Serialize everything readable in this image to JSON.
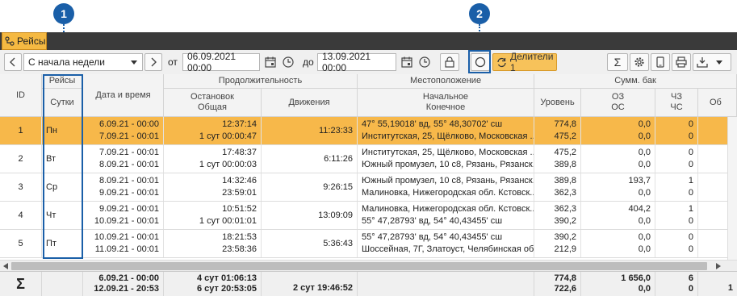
{
  "callouts": [
    "1",
    "2"
  ],
  "tab": {
    "label": "Рейсы"
  },
  "toolbar": {
    "period": "С начала недели",
    "from_label": "от",
    "from_value": "06.09.2021 00:00",
    "to_label": "до",
    "to_value": "13.09.2021 00:00",
    "dividers_label": "Делители 1"
  },
  "headers": {
    "id": "ID",
    "trips": "Рейсы",
    "days": "Сутки",
    "datetime": "Дата и время",
    "duration": "Продолжительность",
    "stops": "Остановок",
    "total": "Общая",
    "moving": "Движения",
    "location": "Местоположение",
    "start": "Начальное",
    "end": "Конечное",
    "tank": "Сумм. бак",
    "level": "Уровень",
    "oz": "ОЗ",
    "os": "ОС",
    "chz": "ЧЗ",
    "chs": "ЧС",
    "ob": "Об"
  },
  "rows": [
    {
      "id": "1",
      "day": "Пн",
      "dt1": "6.09.21 - 00:00",
      "dt2": "7.09.21 - 00:01",
      "stops": "12:37:14",
      "total": "1 сут 00:00:47",
      "moving": "11:23:33",
      "loc1": "47° 55,19018' вд, 55° 48,30702' сш",
      "loc2": "Институтская, 25, Щёлково, Московская ...",
      "lvl1": "774,8",
      "lvl2": "475,2",
      "oz": "0,0",
      "os": "0,0",
      "chz": "0",
      "chs": "0"
    },
    {
      "id": "2",
      "day": "Вт",
      "dt1": "7.09.21 - 00:01",
      "dt2": "8.09.21 - 00:01",
      "stops": "17:48:37",
      "total": "1 сут 00:00:03",
      "moving": "6:11:26",
      "loc1": "Институтская, 25, Щёлково, Московская ...",
      "loc2": "Южный промузел, 10 с8, Рязань, Рязанск...",
      "lvl1": "475,2",
      "lvl2": "389,8",
      "oz": "0,0",
      "os": "0,0",
      "chz": "0",
      "chs": "0"
    },
    {
      "id": "3",
      "day": "Ср",
      "dt1": "8.09.21 - 00:01",
      "dt2": "9.09.21 - 00:01",
      "stops": "14:32:46",
      "total": "23:59:01",
      "moving": "9:26:15",
      "loc1": "Южный промузел, 10 с8, Рязань, Рязанск...",
      "loc2": "Малиновка, Нижегородская обл. Кстовск...",
      "lvl1": "389,8",
      "lvl2": "362,3",
      "oz": "193,7",
      "os": "0,0",
      "chz": "1",
      "chs": "0"
    },
    {
      "id": "4",
      "day": "Чт",
      "dt1": "9.09.21 - 00:01",
      "dt2": "10.09.21 - 00:01",
      "stops": "10:51:52",
      "total": "1 сут 00:01:01",
      "moving": "13:09:09",
      "loc1": "Малиновка, Нижегородская обл. Кстовск...",
      "loc2": "55° 47,28793' вд, 54° 40,43455' сш",
      "lvl1": "362,3",
      "lvl2": "390,2",
      "oz": "404,2",
      "os": "0,0",
      "chz": "1",
      "chs": "0"
    },
    {
      "id": "5",
      "day": "Пт",
      "dt1": "10.09.21 - 00:01",
      "dt2": "11.09.21 - 00:01",
      "stops": "18:21:53",
      "total": "23:58:36",
      "moving": "5:36:43",
      "loc1": "55° 47,28793' вд, 54° 40,43455' сш",
      "loc2": "Шоссейная, 7Г, Златоуст, Челябинская об...",
      "lvl1": "390,2",
      "lvl2": "212,9",
      "oz": "0,0",
      "os": "0,0",
      "chz": "0",
      "chs": "0"
    }
  ],
  "footer": {
    "sigma": "Σ",
    "dt1": "6.09.21 - 00:00",
    "dt2": "12.09.21 - 20:53",
    "stops": "4 сут 01:06:13",
    "total": "6 сут 20:53:05",
    "moving": "2 сут 19:46:52",
    "lvl1": "774,8",
    "lvl2": "722,6",
    "oz": "1 656,0",
    "os": "0,0",
    "chz": "6",
    "chs": "0",
    "ob": "1"
  },
  "colors": {
    "accent": "#f7b84a",
    "callout": "#1a5fa8",
    "darkbar": "#3a3a3a"
  }
}
